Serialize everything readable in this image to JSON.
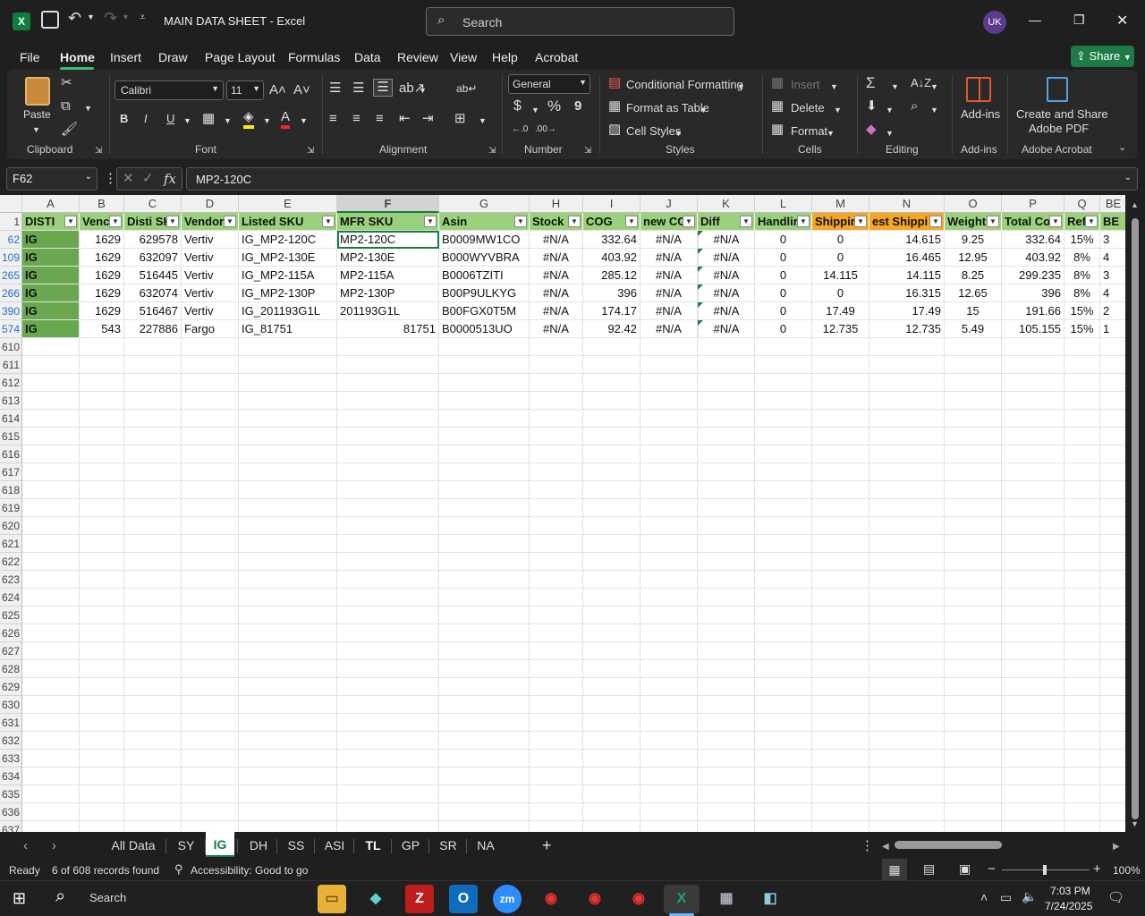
{
  "window": {
    "title": "MAIN DATA SHEET  -  Excel",
    "search_placeholder": "Search",
    "avatar": "UK",
    "minimize": "—",
    "restore": "❐",
    "close": "✕"
  },
  "menu": {
    "items": [
      "File",
      "Home",
      "Insert",
      "Draw",
      "Page Layout",
      "Formulas",
      "Data",
      "Review",
      "View",
      "Help",
      "Acrobat"
    ],
    "active": "Home",
    "share": "Share"
  },
  "ribbon": {
    "clipboard": {
      "label": "Clipboard",
      "paste": "Paste"
    },
    "font": {
      "label": "Font",
      "name": "Calibri",
      "size": "11",
      "bold": "B",
      "italic": "I",
      "underline": "U"
    },
    "alignment": {
      "label": "Alignment"
    },
    "number": {
      "label": "Number",
      "format": "General",
      "currency": "$",
      "percent": "%",
      "comma": "9"
    },
    "styles": {
      "label": "Styles",
      "conditional": "Conditional Formatting",
      "format_table": "Format as Table",
      "cell_styles": "Cell Styles"
    },
    "cells": {
      "label": "Cells",
      "insert": "Insert",
      "delete": "Delete",
      "format": "Format"
    },
    "editing": {
      "label": "Editing"
    },
    "addins": {
      "label": "Add-ins",
      "button": "Add-ins"
    },
    "acrobat": {
      "label": "Adobe Acrobat",
      "button_line1": "Create and Share",
      "button_line2": "Adobe PDF"
    }
  },
  "formula": {
    "name_box": "F62",
    "fx": "fx",
    "content": "MP2-120C"
  },
  "columns": [
    "A",
    "B",
    "C",
    "D",
    "E",
    "F",
    "G",
    "H",
    "I",
    "J",
    "K",
    "L",
    "M",
    "N",
    "O",
    "P",
    "Q",
    "BE"
  ],
  "header_row": {
    "num": "1",
    "cells": [
      "DISTI",
      "Venc",
      "Disti SK",
      "Vendor",
      "Listed SKU",
      "MFR SKU",
      "Asin",
      "Stock",
      "COG",
      "new CC",
      "Diff",
      "Handlir",
      "Shippir",
      "est Shippi",
      "Weight",
      "Total Co",
      "Reff",
      "BE"
    ]
  },
  "rows": [
    {
      "num": "62",
      "cells": [
        "IG",
        "1629",
        "629578",
        "Vertiv",
        "IG_MP2-120C",
        "MP2-120C",
        "B0009MW1CO",
        "#N/A",
        "332.64",
        "#N/A",
        "#N/A",
        "0",
        "0",
        "14.615",
        "9.25",
        "332.64",
        "15%",
        "3"
      ]
    },
    {
      "num": "109",
      "cells": [
        "IG",
        "1629",
        "632097",
        "Vertiv",
        "IG_MP2-130E",
        "MP2-130E",
        "B000WYVBRA",
        "#N/A",
        "403.92",
        "#N/A",
        "#N/A",
        "0",
        "0",
        "16.465",
        "12.95",
        "403.92",
        "8%",
        "4"
      ]
    },
    {
      "num": "265",
      "cells": [
        "IG",
        "1629",
        "516445",
        "Vertiv",
        "IG_MP2-115A",
        "MP2-115A",
        "B0006TZITI",
        "#N/A",
        "285.12",
        "#N/A",
        "#N/A",
        "0",
        "14.115",
        "14.115",
        "8.25",
        "299.235",
        "8%",
        "3"
      ]
    },
    {
      "num": "266",
      "cells": [
        "IG",
        "1629",
        "632074",
        "Vertiv",
        "IG_MP2-130P",
        "MP2-130P",
        "B00P9ULKYG",
        "#N/A",
        "396",
        "#N/A",
        "#N/A",
        "0",
        "0",
        "16.315",
        "12.65",
        "396",
        "8%",
        "4"
      ]
    },
    {
      "num": "390",
      "cells": [
        "IG",
        "1629",
        "516467",
        "Vertiv",
        "IG_201193G1L",
        "201193G1L",
        "B00FGX0T5M",
        "#N/A",
        "174.17",
        "#N/A",
        "#N/A",
        "0",
        "17.49",
        "17.49",
        "15",
        "191.66",
        "15%",
        "2"
      ]
    },
    {
      "num": "574",
      "cells": [
        "IG",
        "543",
        "227886",
        "Fargo",
        "IG_81751",
        "81751",
        "B0000513UO",
        "#N/A",
        "92.42",
        "#N/A",
        "#N/A",
        "0",
        "12.735",
        "12.735",
        "5.49",
        "105.155",
        "15%",
        "1"
      ]
    }
  ],
  "empty_rows": [
    "610",
    "611",
    "612",
    "613",
    "614",
    "615",
    "616",
    "617",
    "618",
    "619",
    "620",
    "621",
    "622",
    "623",
    "624",
    "625",
    "626",
    "627",
    "628",
    "629",
    "630",
    "631",
    "632",
    "633",
    "634",
    "635",
    "636",
    "637"
  ],
  "sheets": [
    "All Data",
    "SY",
    "IG",
    "DH",
    "SS",
    "ASI",
    "TL",
    "GP",
    "SR",
    "NA"
  ],
  "active_sheet": "IG",
  "status": {
    "ready": "Ready",
    "records": "6 of 608 records found",
    "accessibility": "Accessibility: Good to go",
    "zoom": "100%"
  },
  "taskbar": {
    "search": "Search",
    "time": "7:03 PM",
    "date": "7/24/2025"
  },
  "colors": {
    "header_green": "#9bd17c",
    "header_orange": "#f5a623",
    "disti_fill": "#6aa84f",
    "excel_green": "#107c41"
  }
}
